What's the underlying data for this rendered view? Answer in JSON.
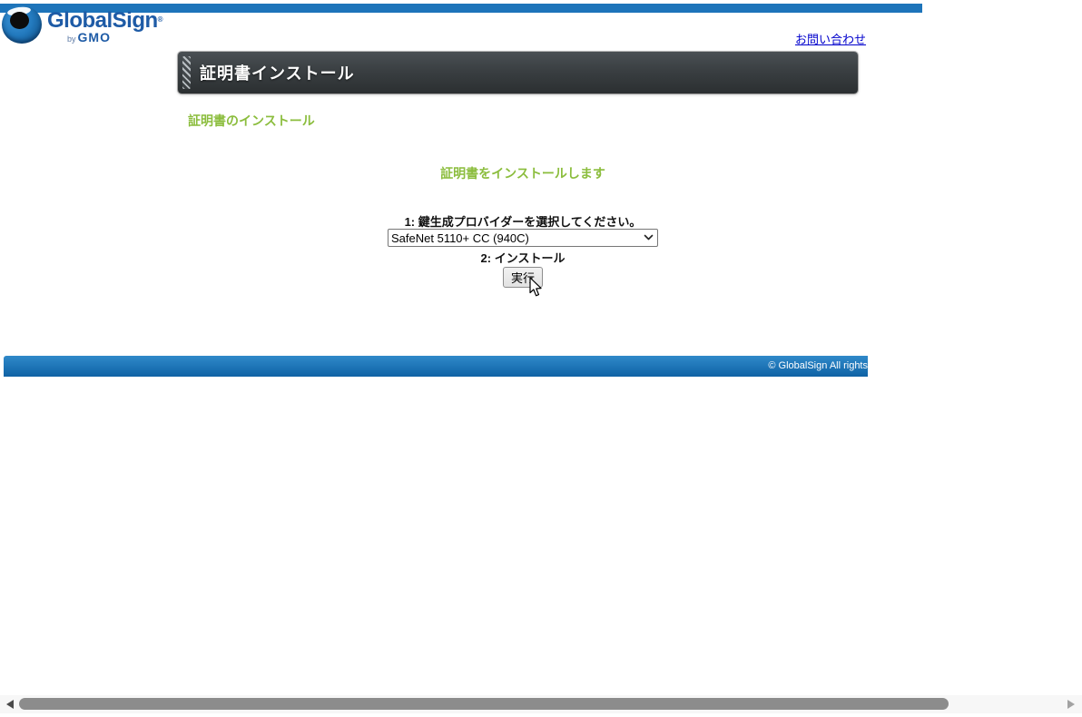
{
  "brand": {
    "name": "GlobalSign",
    "mark": "®",
    "by": "by",
    "company": "GMO"
  },
  "nav": {
    "contact_link": "お問い合わせ"
  },
  "title_bar": {
    "title": "証明書インストール"
  },
  "content": {
    "section_heading": "証明書のインストール",
    "intro_message": "証明書をインストールします",
    "step1_label": "1: 鍵生成プロバイダーを選択してください。",
    "provider_selected": "SafeNet 5110+ CC (940C)",
    "step2_label": "2: インストール",
    "execute_button_label": "実行"
  },
  "footer": {
    "copyright": "© GlobalSign All rights"
  },
  "colors": {
    "top_bar_blue": "#1d74ba",
    "footer_blue_top": "#3089c9",
    "footer_blue_bottom": "#0f62a4",
    "brand_blue": "#1e5ba6",
    "accent_green": "#8bbd3d",
    "title_bar_dark": "#35393c",
    "link_blue": "#0000cc"
  }
}
